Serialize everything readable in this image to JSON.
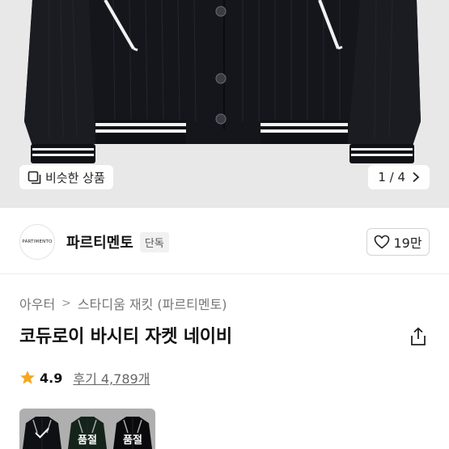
{
  "hero": {
    "similar_label": "비슷한 상품",
    "similar_icon": "similar-products-icon",
    "page_current": "1",
    "page_total": "4",
    "page_text": "1 / 4",
    "next_icon": "chevron-right-icon"
  },
  "brand": {
    "logo_text": "PARTIMENTO",
    "name": "파르티멘토",
    "badge": "단독",
    "like_icon": "heart-icon",
    "like_count": "19만"
  },
  "breadcrumb": {
    "items": [
      "아우터",
      "스타디움 재킷 (파르티멘토)"
    ],
    "separator": ">"
  },
  "product": {
    "title": "코듀로이 바시티 자켓 네이비",
    "share_icon": "share-icon"
  },
  "rating": {
    "star_icon": "star-icon",
    "score": "4.9",
    "reviews": "후기 4,789개"
  },
  "variants": {
    "items": [
      {
        "state": "selected",
        "icon": "check-icon"
      },
      {
        "state": "soldout",
        "label": "품절"
      },
      {
        "state": "soldout",
        "label": "품절"
      }
    ]
  },
  "colors": {
    "hero_bg": "#e8e8e8",
    "jacket": "#14161c",
    "star": "#f5a623",
    "text_primary": "#111111",
    "text_secondary": "#777777"
  }
}
